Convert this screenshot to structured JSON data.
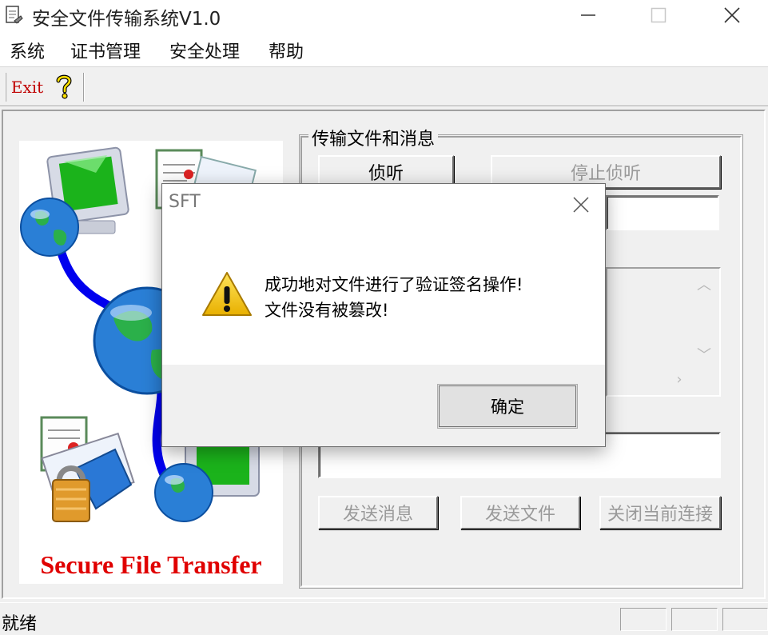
{
  "window": {
    "title": "安全文件传输系统V1.0",
    "controls": {
      "minimize": "minimize-icon",
      "maximize": "maximize-icon",
      "close": "close-icon"
    }
  },
  "menu": {
    "items": [
      {
        "label": "系统"
      },
      {
        "label": "证书管理"
      },
      {
        "label": "安全处理"
      },
      {
        "label": "帮助"
      }
    ]
  },
  "toolbar": {
    "exit_label": "Exit",
    "help_icon": "help-question-icon"
  },
  "illustration": {
    "caption": "Secure File Transfer",
    "icons": [
      "computer-icon",
      "globe-icon",
      "certificate-icon",
      "padlock-icon"
    ]
  },
  "transfer_group": {
    "legend": "传输文件和消息",
    "listen_label": "侦听",
    "stop_listen_label": "停止侦听",
    "ip_value": "",
    "send_field_value": "",
    "send_message_label": "发送消息",
    "send_file_label": "发送文件",
    "close_connection_label": "关闭当前连接"
  },
  "status_bar": {
    "text": "就绪"
  },
  "dialog": {
    "title": "SFT",
    "icon": "warning-icon",
    "message_line1": "成功地对文件进行了验证签名操作!",
    "message_line2": "文件没有被篡改!",
    "ok_label": "确定"
  },
  "colors": {
    "window_bg": "#f0f0f0",
    "caption_red": "#e00000",
    "exit_red": "#c00000",
    "warning_yellow": "#f5c400"
  }
}
